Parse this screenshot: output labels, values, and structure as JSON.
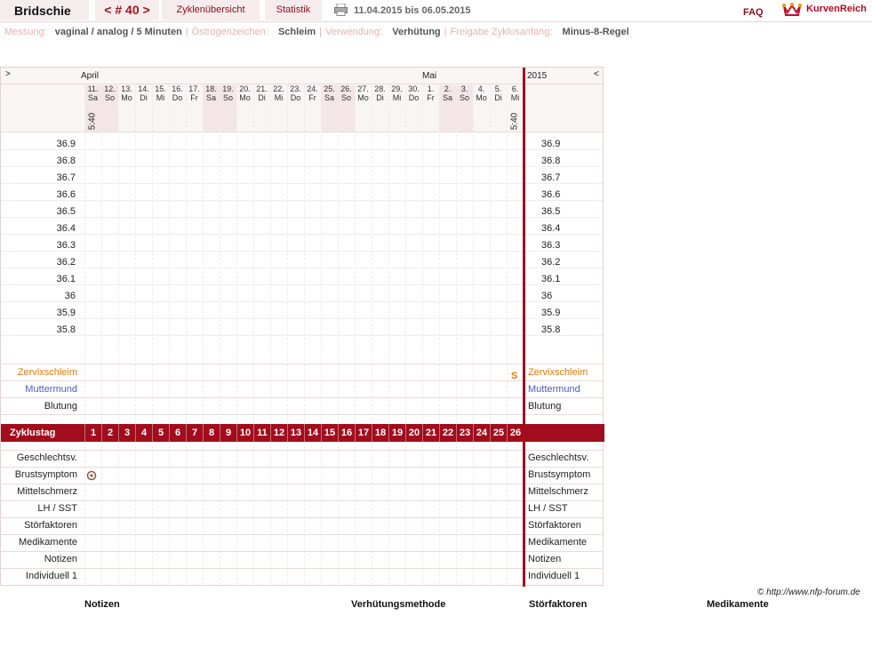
{
  "header": {
    "brand": "Bridschie",
    "cycle_nav": "< # 40 >",
    "cycles_overview": "Zyklenübersicht",
    "statistics": "Statistik",
    "date_range": "11.04.2015 bis 06.05.2015",
    "faq": "FAQ",
    "logo_text": "KurvenReich"
  },
  "settings": {
    "measurement_label": "Messung:",
    "measurement_value": "vaginal / analog / 5 Minuten",
    "estrogen_label": "Östrogenzeichen:",
    "estrogen_value": "Schleim",
    "usage_label": "Verwendung:",
    "usage_value": "Verhütung",
    "release_label": "Freigabe Zyklusanfang:",
    "release_value": "Minus-8-Regel"
  },
  "chart": {
    "nav_left": ">",
    "nav_right": "<",
    "month_april": "April",
    "month_may": "Mai",
    "year": "2015",
    "days": [
      {
        "date": "11.",
        "dow": "Sa",
        "weekend": true,
        "time": "5:40"
      },
      {
        "date": "12.",
        "dow": "So",
        "weekend": true
      },
      {
        "date": "13.",
        "dow": "Mo"
      },
      {
        "date": "14.",
        "dow": "Di"
      },
      {
        "date": "15.",
        "dow": "Mi"
      },
      {
        "date": "16.",
        "dow": "Do"
      },
      {
        "date": "17.",
        "dow": "Fr"
      },
      {
        "date": "18.",
        "dow": "Sa",
        "weekend": true
      },
      {
        "date": "19.",
        "dow": "So",
        "weekend": true
      },
      {
        "date": "20.",
        "dow": "Mo"
      },
      {
        "date": "21.",
        "dow": "Di"
      },
      {
        "date": "22.",
        "dow": "Mi"
      },
      {
        "date": "23.",
        "dow": "Do"
      },
      {
        "date": "24.",
        "dow": "Fr"
      },
      {
        "date": "25.",
        "dow": "Sa",
        "weekend": true
      },
      {
        "date": "26.",
        "dow": "So",
        "weekend": true
      },
      {
        "date": "27.",
        "dow": "Mo"
      },
      {
        "date": "28.",
        "dow": "Di"
      },
      {
        "date": "29.",
        "dow": "Mi"
      },
      {
        "date": "30.",
        "dow": "Do"
      },
      {
        "date": "1.",
        "dow": "Fr"
      },
      {
        "date": "2.",
        "dow": "Sa",
        "weekend": true
      },
      {
        "date": "3.",
        "dow": "So",
        "weekend": true
      },
      {
        "date": "4.",
        "dow": "Mo"
      },
      {
        "date": "5.",
        "dow": "Di"
      },
      {
        "date": "6.",
        "dow": "Mi",
        "time": "5:40"
      }
    ],
    "temperatures": [
      "36.9",
      "36.8",
      "36.7",
      "36.6",
      "36.5",
      "36.4",
      "36.3",
      "36.2",
      "36.1",
      "36",
      "35.9",
      "35.8"
    ],
    "rows_top": [
      {
        "label": "Zervixschleim",
        "color": "#e07a10"
      },
      {
        "label": "Muttermund",
        "color": "#4a5bc4"
      },
      {
        "label": "Blutung",
        "color": "#222222"
      }
    ],
    "cervix_mark": "S",
    "cycle_label": "Zyklustag",
    "cycle_days": [
      "1",
      "2",
      "3",
      "4",
      "5",
      "6",
      "7",
      "8",
      "9",
      "10",
      "11",
      "12",
      "13",
      "14",
      "15",
      "16",
      "17",
      "18",
      "19",
      "20",
      "21",
      "22",
      "23",
      "24",
      "25",
      "26"
    ],
    "rows_bottom": [
      "Geschlechtsv.",
      "Brustsymptom",
      "Mittelschmerz",
      "LH / SST",
      "Störfaktoren",
      "Medikamente",
      "Notizen",
      "Individuell 1"
    ],
    "colors": {
      "accent": "#a10d1d",
      "weekend": "#f4e6e6"
    }
  },
  "footer": {
    "copyright": "© http://www.nfp-forum.de",
    "notes": "Notizen",
    "method": "Verhütungsmethode",
    "disturb": "Störfaktoren",
    "meds": "Medikamente"
  }
}
